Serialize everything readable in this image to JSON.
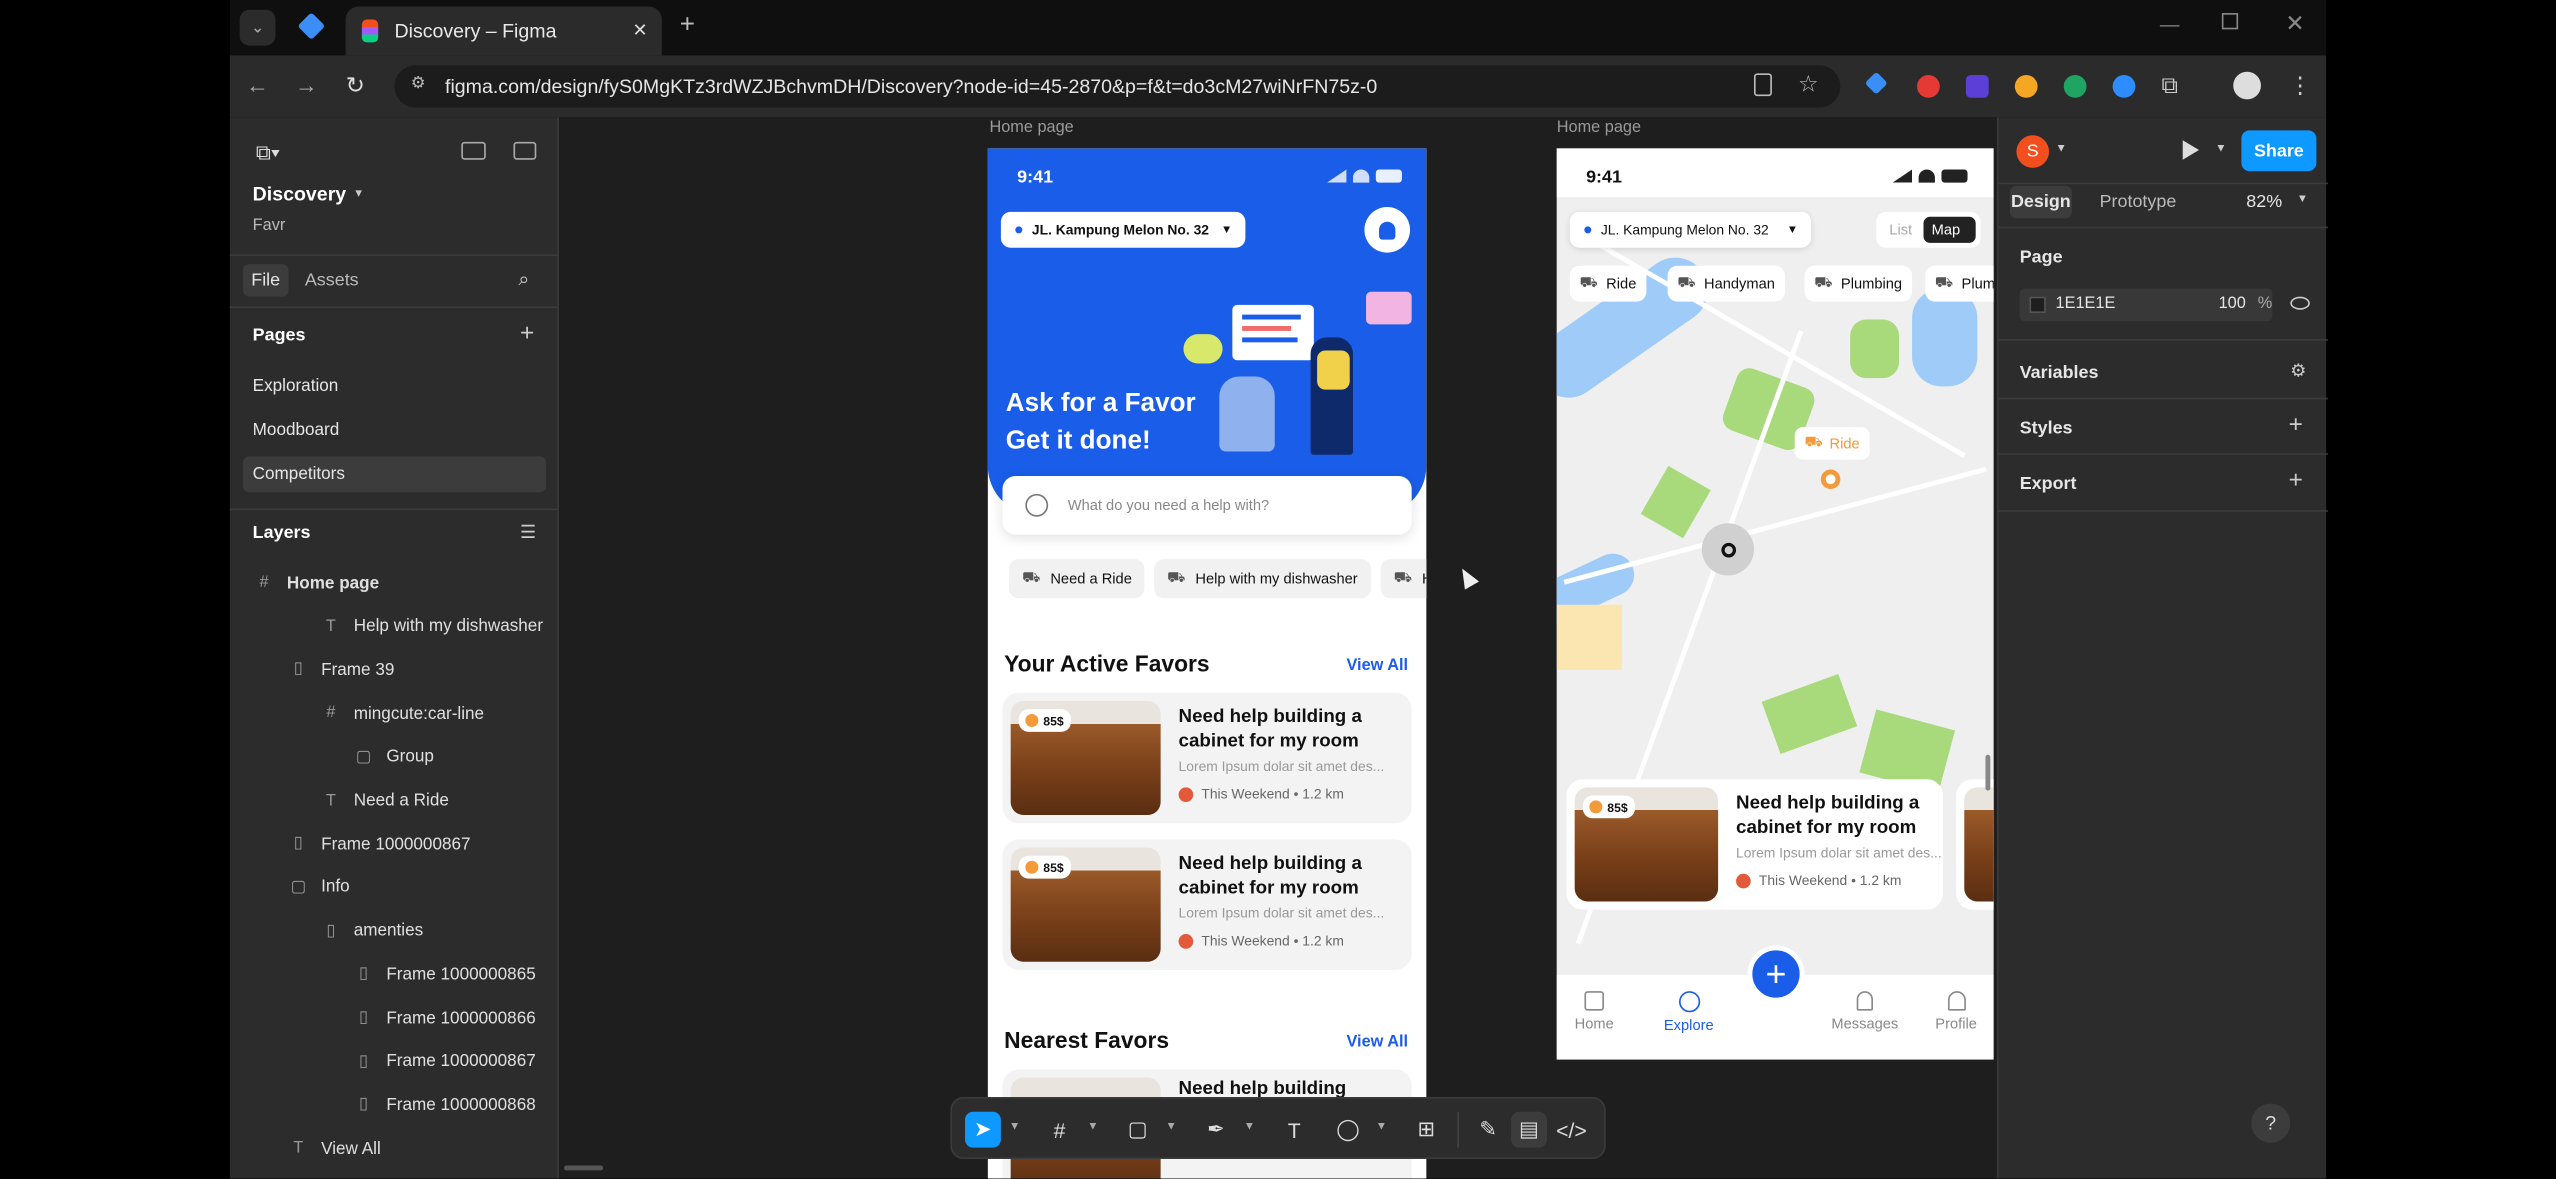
{
  "browser": {
    "tab_title": "Discovery – Figma",
    "url": "figma.com/design/fyS0MgKTz3rdWZJBchvmDH/Discovery?node-id=45-2870&p=f&t=do3cM27wiNrFN75z-0"
  },
  "left_panel": {
    "file_name": "Discovery",
    "project_name": "Favr",
    "tabs": [
      "File",
      "Assets"
    ],
    "pages_title": "Pages",
    "pages": [
      "Exploration",
      "Moodboard",
      "Competitors"
    ],
    "layers_title": "Layers",
    "layers": [
      {
        "label": "Home page",
        "icon": "frame-icon"
      },
      {
        "label": "Help with my dishwasher",
        "icon": "text-icon"
      },
      {
        "label": "Frame 39",
        "icon": "autolayout-icon"
      },
      {
        "label": "mingcute:car-line",
        "icon": "frame-icon"
      },
      {
        "label": "Group",
        "icon": "group-icon"
      },
      {
        "label": "Need a Ride",
        "icon": "text-icon"
      },
      {
        "label": "Frame 1000000867",
        "icon": "autolayout-icon"
      },
      {
        "label": "Info",
        "icon": "group-icon"
      },
      {
        "label": "amenties",
        "icon": "autolayout-icon"
      },
      {
        "label": "Frame 1000000865",
        "icon": "autolayout-icon"
      },
      {
        "label": "Frame 1000000866",
        "icon": "autolayout-icon"
      },
      {
        "label": "Frame 1000000867",
        "icon": "autolayout-icon"
      },
      {
        "label": "Frame 1000000868",
        "icon": "autolayout-icon"
      },
      {
        "label": "View All",
        "icon": "text-icon"
      }
    ]
  },
  "right_panel": {
    "avatar_letter": "S",
    "share_label": "Share",
    "tabs": [
      "Design",
      "Prototype"
    ],
    "zoom": "82%",
    "page_section": "Page",
    "page_color": "1E1E1E",
    "page_opacity": "100",
    "percent_sign": "%",
    "sections": [
      "Variables",
      "Styles",
      "Export"
    ]
  },
  "canvas": {
    "frame_label_1": "Home page",
    "frame_label_2": "Home page",
    "phone1": {
      "time": "9:41",
      "location": "JL. Kampung Melon No. 32",
      "hero_line1": "Ask for a Favor",
      "hero_line2": "Get it done!",
      "search_placeholder": "What do you need a help with?",
      "chips": [
        "Need a Ride",
        "Help with my dishwasher",
        "H"
      ],
      "active_title": "Your Active Favors",
      "view_all": "View All",
      "cards": [
        {
          "badge": "85$",
          "title": "Need help building a cabinet for my room",
          "desc": "Lorem Ipsum dolar sit amet des...",
          "when": "This Weekend",
          "dist": "• 1.2 km"
        },
        {
          "badge": "85$",
          "title": "Need help building a cabinet for my room",
          "desc": "Lorem Ipsum dolar sit amet des...",
          "when": "This Weekend",
          "dist": "• 1.2 km"
        }
      ],
      "nearest_title": "Nearest Favors",
      "nearest_view_all": "View All",
      "nearest_peek": "Need help building"
    },
    "phone2": {
      "time": "9:41",
      "location": "JL. Kampung Melon No. 32",
      "toggle": [
        "List",
        "Map"
      ],
      "chips": [
        "Ride",
        "Handyman",
        "Plumbing",
        "Plum"
      ],
      "map_pin_label": "Ride",
      "card": {
        "badge": "85$",
        "title": "Need help building a cabinet for my room",
        "desc": "Lorem Ipsum dolar sit amet des...",
        "when": "This Weekend",
        "dist": "• 1.2 km"
      },
      "nav": [
        "Home",
        "Explore",
        "Messages",
        "Profile"
      ]
    }
  },
  "bottom_toolbar": {
    "tools": [
      "move-icon",
      "frame-icon",
      "rectangle-icon",
      "pen-icon",
      "text-icon",
      "comment-icon",
      "actions-icon",
      "draw-icon",
      "design-mode-icon",
      "dev-mode-icon"
    ]
  },
  "help_label": "?",
  "colors": {
    "figma_panel": "#2c2c2c",
    "canvas_bg": "#1e1e1e",
    "accent_blue": "#1a5de8",
    "share_blue": "#0d99ff"
  }
}
